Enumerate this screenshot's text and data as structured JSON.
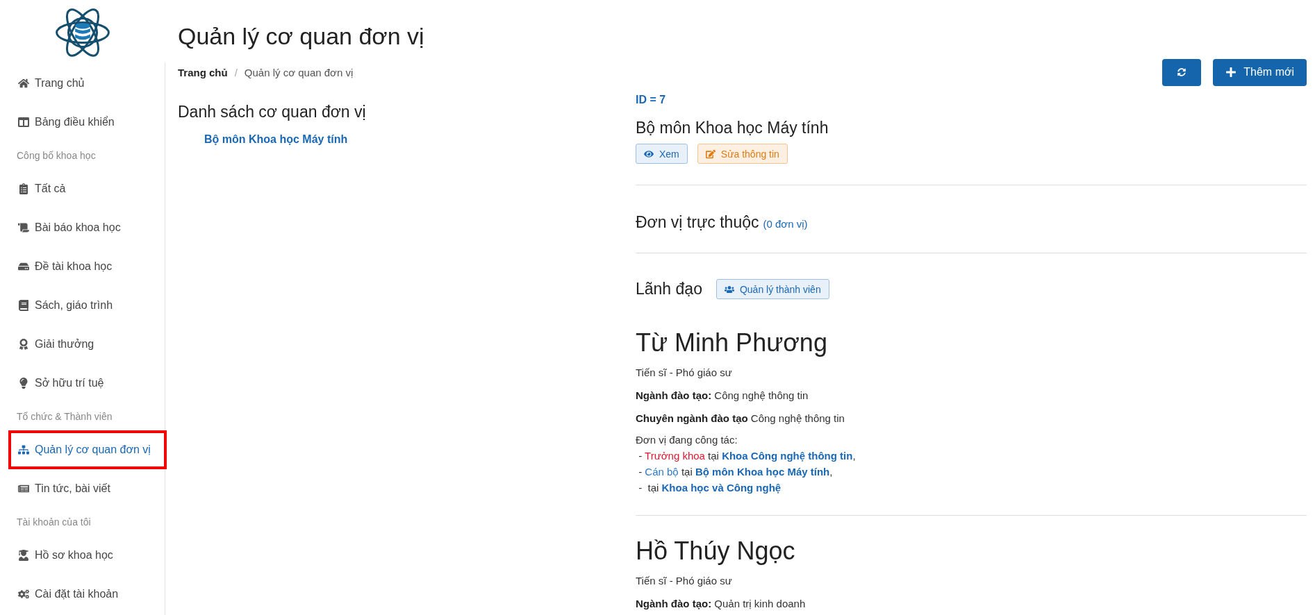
{
  "sidebar": {
    "items": [
      {
        "kind": "link",
        "label": "Trang chủ",
        "selected": false
      },
      {
        "kind": "link",
        "label": "Bảng điều khiển",
        "selected": false
      },
      {
        "kind": "section",
        "label": "Công bố khoa học"
      },
      {
        "kind": "link",
        "label": "Tất cả",
        "selected": false
      },
      {
        "kind": "link",
        "label": "Bài báo khoa học",
        "selected": false
      },
      {
        "kind": "link",
        "label": "Đề tài khoa học",
        "selected": false
      },
      {
        "kind": "link",
        "label": "Sách, giáo trình",
        "selected": false
      },
      {
        "kind": "link",
        "label": "Giải thưởng",
        "selected": false
      },
      {
        "kind": "link",
        "label": "Sở hữu trí tuệ",
        "selected": false
      },
      {
        "kind": "section",
        "label": "Tổ chức & Thành viên"
      },
      {
        "kind": "link",
        "label": "Quản lý cơ quan đơn vị",
        "selected": true
      },
      {
        "kind": "link",
        "label": "Tin tức, bài viết",
        "selected": false
      },
      {
        "kind": "section",
        "label": "Tài khoản của tôi"
      },
      {
        "kind": "link",
        "label": "Hồ sơ khoa học",
        "selected": false
      },
      {
        "kind": "link",
        "label": "Cài đặt tài khoản",
        "selected": false
      }
    ]
  },
  "page_title": "Quản lý cơ quan đơn vị",
  "breadcrumb": {
    "separator": "/",
    "items": [
      {
        "label": "Trang chủ",
        "current": false
      },
      {
        "label": "Quản lý cơ quan đơn vị",
        "current": true
      }
    ]
  },
  "toolbar": {
    "add_button": "Thêm mới"
  },
  "unit_list": {
    "title": "Danh sách cơ quan đơn vị",
    "items": [
      {
        "label": "Bộ môn Khoa học Máy tính"
      }
    ]
  },
  "detail": {
    "id": "ID = 7",
    "name": "Bộ môn Khoa học Máy tính",
    "view_button": "Xem",
    "edit_button": "Sửa thông tin",
    "subunits": {
      "title": "Đơn vị trực thuộc",
      "count": "(0 đơn vị)"
    },
    "leaders": {
      "title": "Lãnh đạo",
      "manage_button": "Quản lý thành viên",
      "people": [
        {
          "name": "Từ Minh Phương",
          "degree": "Tiến sĩ - Phó giáo sư",
          "fields": [
            "**Ngành đào tạo:** Công nghệ thông tin",
            "**Chuyên ngành đào tạo** Công nghệ thông tin"
          ],
          "workplaces_title": "Đơn vị đang công tác:",
          "workplaces": [
            {
              "dash": "-",
              "role": "Trưởng khoa",
              "color": "#e0182d",
              "at": "tại",
              "unit": "Khoa Công nghệ thông tin",
              "sep": ","
            },
            {
              "dash": "-",
              "role": "Cán bộ",
              "color": "#2b7bc9",
              "at": "tại",
              "unit": "Bộ môn Khoa học Máy tính",
              "sep": ","
            },
            {
              "dash": "-",
              "at": "tại",
              "unit": "Khoa học và Công nghệ"
            }
          ]
        },
        {
          "name": "Hồ Thúy Ngọc",
          "degree": "Tiến sĩ - Phó giáo sư",
          "fields": [
            "**Ngành đào tạo:** Quản trị kinh doanh"
          ]
        }
      ]
    }
  }
}
